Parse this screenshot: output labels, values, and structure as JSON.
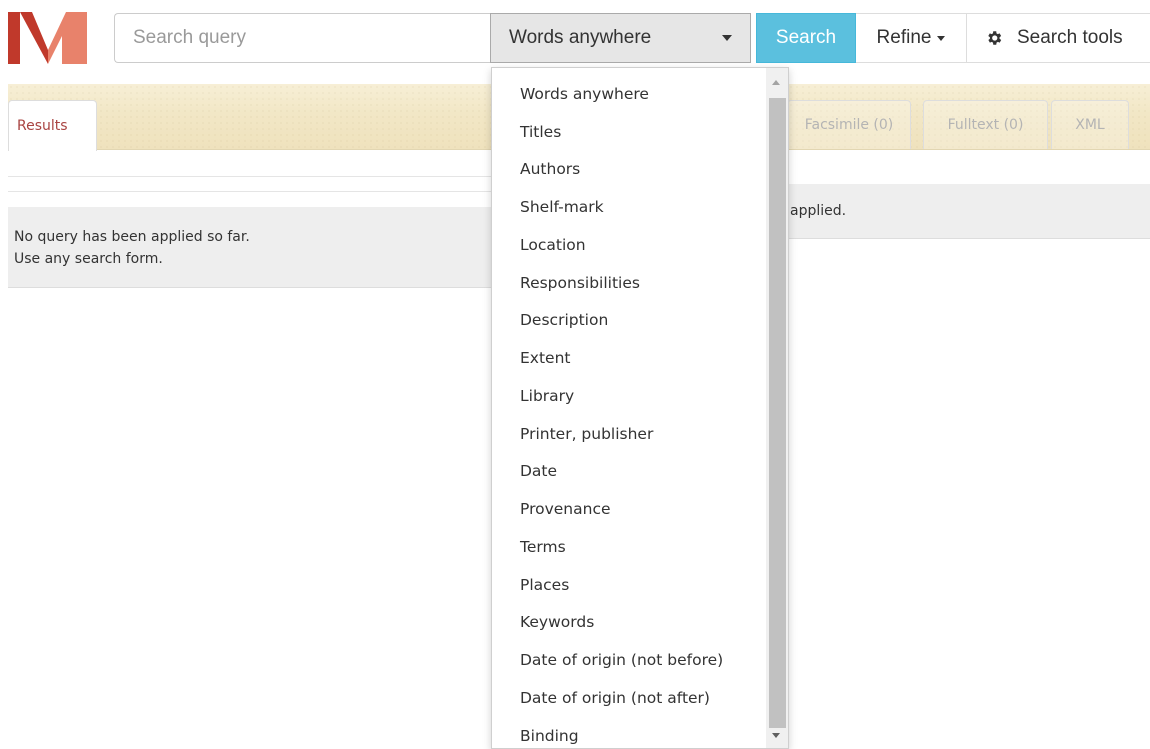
{
  "header": {
    "logo_letter": "M",
    "search_placeholder": "Search query",
    "field_selected": "Words anywhere",
    "search_label": "Search",
    "refine_label": "Refine",
    "tools_label": "Search tools"
  },
  "tabs": {
    "results": "Results",
    "facsimile": "Facsimile (0)",
    "fulltext": "Fulltext (0)",
    "xml": "XML"
  },
  "messages": {
    "left_line1": "No query has been applied so far.",
    "left_line2": "Use any search form.",
    "right_partial": "applied."
  },
  "dropdown": {
    "options": [
      "Words anywhere",
      "Titles",
      "Authors",
      "Shelf-mark",
      "Location",
      "Responsibilities",
      "Description",
      "Extent",
      "Library",
      "Printer, publisher",
      "Date",
      "Provenance",
      "Terms",
      "Places",
      "Keywords",
      "Date of origin (not before)",
      "Date of origin (not after)",
      "Binding"
    ]
  },
  "colors": {
    "logo_dark": "#c0392b",
    "logo_light": "#e8826b",
    "search_button": "#5bc0de",
    "active_tab_text": "#a94442",
    "tab_strip": "#f2e7c6"
  }
}
